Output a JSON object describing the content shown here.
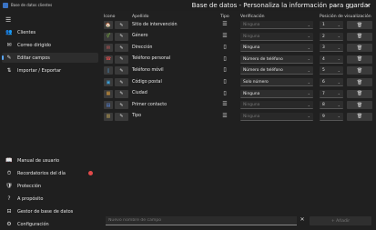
{
  "app": {
    "name": "Base de datos clientes",
    "title": "Base de datos - Personaliza la información para guardar"
  },
  "window": {
    "minimize": "—",
    "maximize": "▢",
    "close": "✕"
  },
  "sidebar": {
    "menu_icon": "hamburger-icon",
    "top_items": [
      {
        "label": "Clientes",
        "icon": "people-icon"
      },
      {
        "label": "Correo dirigido",
        "icon": "mail-icon"
      },
      {
        "label": "Editar campos",
        "icon": "edit-icon",
        "active": true
      },
      {
        "label": "Importar / Exportar",
        "icon": "import-export-icon"
      }
    ],
    "bottom_items": [
      {
        "label": "Manual de usuario",
        "icon": "book-icon"
      },
      {
        "label": "Recordatorios del día",
        "icon": "clock-icon",
        "badge": true
      },
      {
        "label": "Protección",
        "icon": "shield-icon"
      },
      {
        "label": "A propósito",
        "icon": "info-icon"
      },
      {
        "label": "Gestor de base de datos",
        "icon": "database-icon"
      },
      {
        "label": "Configuración",
        "icon": "gear-icon"
      }
    ]
  },
  "table": {
    "headers": {
      "icon": "Icono",
      "name": "Apellido",
      "type": "Tipo",
      "verification": "Verificación",
      "position": "Posición de visualización"
    },
    "rows": [
      {
        "name": "Sitio de intervención",
        "icon": "home-icon",
        "type": "text-icon",
        "verification": "Ninguna",
        "verif_enabled": false,
        "position": "1"
      },
      {
        "name": "Género",
        "icon": "gender-icon",
        "type": "text-icon",
        "verification": "Ninguna",
        "verif_enabled": false,
        "position": "2"
      },
      {
        "name": "Dirección",
        "icon": "address-icon",
        "type": "document-icon",
        "verification": "Ninguna",
        "verif_enabled": true,
        "position": "3"
      },
      {
        "name": "Teléfono personal",
        "icon": "phone-icon",
        "type": "document-icon",
        "verification": "Número de teléfono",
        "verif_enabled": true,
        "position": "4"
      },
      {
        "name": "Teléfono móvil",
        "icon": "mobile-icon",
        "type": "document-icon",
        "verification": "Número de teléfono",
        "verif_enabled": true,
        "position": "5"
      },
      {
        "name": "Código postal",
        "icon": "postal-icon",
        "type": "document-icon",
        "verification": "Solo número",
        "verif_enabled": true,
        "position": "6"
      },
      {
        "name": "Ciudad",
        "icon": "city-icon",
        "type": "document-icon",
        "verification": "Ninguna",
        "verif_enabled": true,
        "position": "7"
      },
      {
        "name": "Primer contacto",
        "icon": "calendar-icon",
        "type": "text-icon",
        "verification": "Ninguna",
        "verif_enabled": false,
        "position": "8"
      },
      {
        "name": "Tipo",
        "icon": "clipboard-icon",
        "type": "text-icon",
        "verification": "Ninguna",
        "verif_enabled": false,
        "position": "9"
      }
    ]
  },
  "footer": {
    "new_field_placeholder": "Nuevo nombre de campo",
    "add_label": "+ Añadir"
  },
  "colors": {
    "accent": "#5aa8ff",
    "badge": "#e24a4a"
  }
}
